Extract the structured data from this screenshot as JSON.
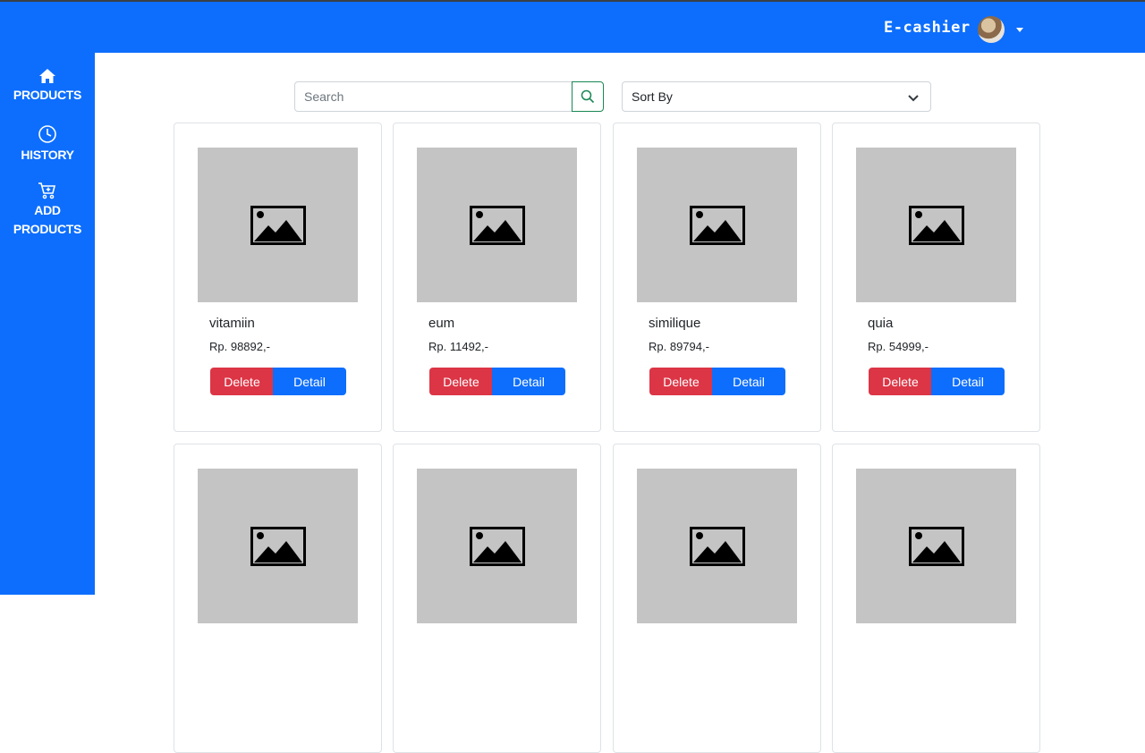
{
  "header": {
    "brand": "E-cashier",
    "avatar_icon": "user-avatar",
    "dropdown_icon": "caret-down-icon",
    "accent": "#0d6efd"
  },
  "sidebar": {
    "items": [
      {
        "label": "PRODUCTS",
        "icon": "home-icon"
      },
      {
        "label": "HISTORY",
        "icon": "clock-icon"
      },
      {
        "label_line1": "ADD",
        "label_line2": "PRODUCTS",
        "icon": "cart-plus-icon"
      }
    ]
  },
  "toolbar": {
    "search_placeholder": "Search",
    "search_icon": "search-icon",
    "sort_label": "Sort By",
    "sort_icon": "chevron-down-icon"
  },
  "products": [
    {
      "name": "vitamiin",
      "price": "Rp. 98892,-",
      "delete_label": "Delete",
      "detail_label": "Detail"
    },
    {
      "name": "eum",
      "price": "Rp. 11492,-",
      "delete_label": "Delete",
      "detail_label": "Detail"
    },
    {
      "name": "similique",
      "price": "Rp. 89794,-",
      "delete_label": "Delete",
      "detail_label": "Detail"
    },
    {
      "name": "quia",
      "price": "Rp. 54999,-",
      "delete_label": "Delete",
      "detail_label": "Detail"
    },
    {
      "name": "",
      "price": "",
      "delete_label": "",
      "detail_label": ""
    },
    {
      "name": "",
      "price": "",
      "delete_label": "",
      "detail_label": ""
    },
    {
      "name": "",
      "price": "",
      "delete_label": "",
      "detail_label": ""
    },
    {
      "name": "",
      "price": "",
      "delete_label": "",
      "detail_label": ""
    }
  ],
  "colors": {
    "primary": "#0d6efd",
    "danger": "#dc3545",
    "success": "#198754",
    "placeholder_image": "#c4c4c4"
  }
}
